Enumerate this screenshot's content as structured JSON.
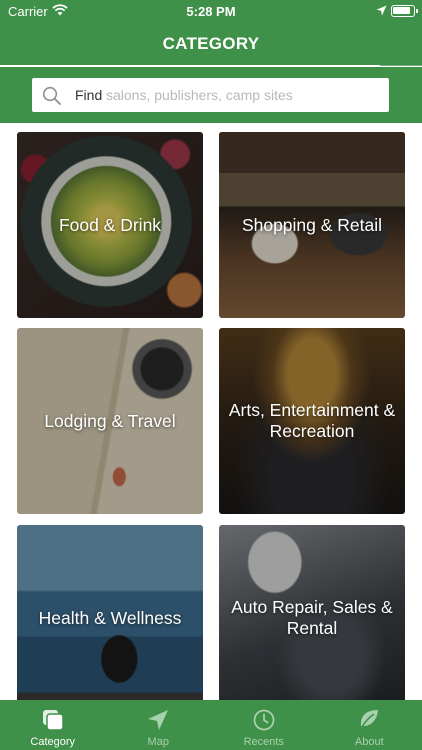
{
  "status_bar": {
    "carrier": "Carrier",
    "time": "5:28 PM"
  },
  "header": {
    "title": "CATEGORY",
    "progress": 0.9
  },
  "search": {
    "prefix": "Find",
    "placeholder": "salons, publishers, camp sites"
  },
  "categories": [
    {
      "label": "Food & Drink"
    },
    {
      "label": "Shopping & Retail"
    },
    {
      "label": "Lodging & Travel"
    },
    {
      "label": "Arts, Entertainment & Recreation"
    },
    {
      "label": "Health & Wellness"
    },
    {
      "label": "Auto Repair, Sales & Rental"
    }
  ],
  "tabs": [
    {
      "label": "Category",
      "icon": "category-icon",
      "active": true
    },
    {
      "label": "Map",
      "icon": "map-arrow-icon",
      "active": false
    },
    {
      "label": "Recents",
      "icon": "recents-clock-icon",
      "active": false
    },
    {
      "label": "About",
      "icon": "leaf-icon",
      "active": false
    }
  ],
  "colors": {
    "brand_green": "#3f9049",
    "tab_inactive": "#a8d1ad",
    "white": "#ffffff"
  }
}
